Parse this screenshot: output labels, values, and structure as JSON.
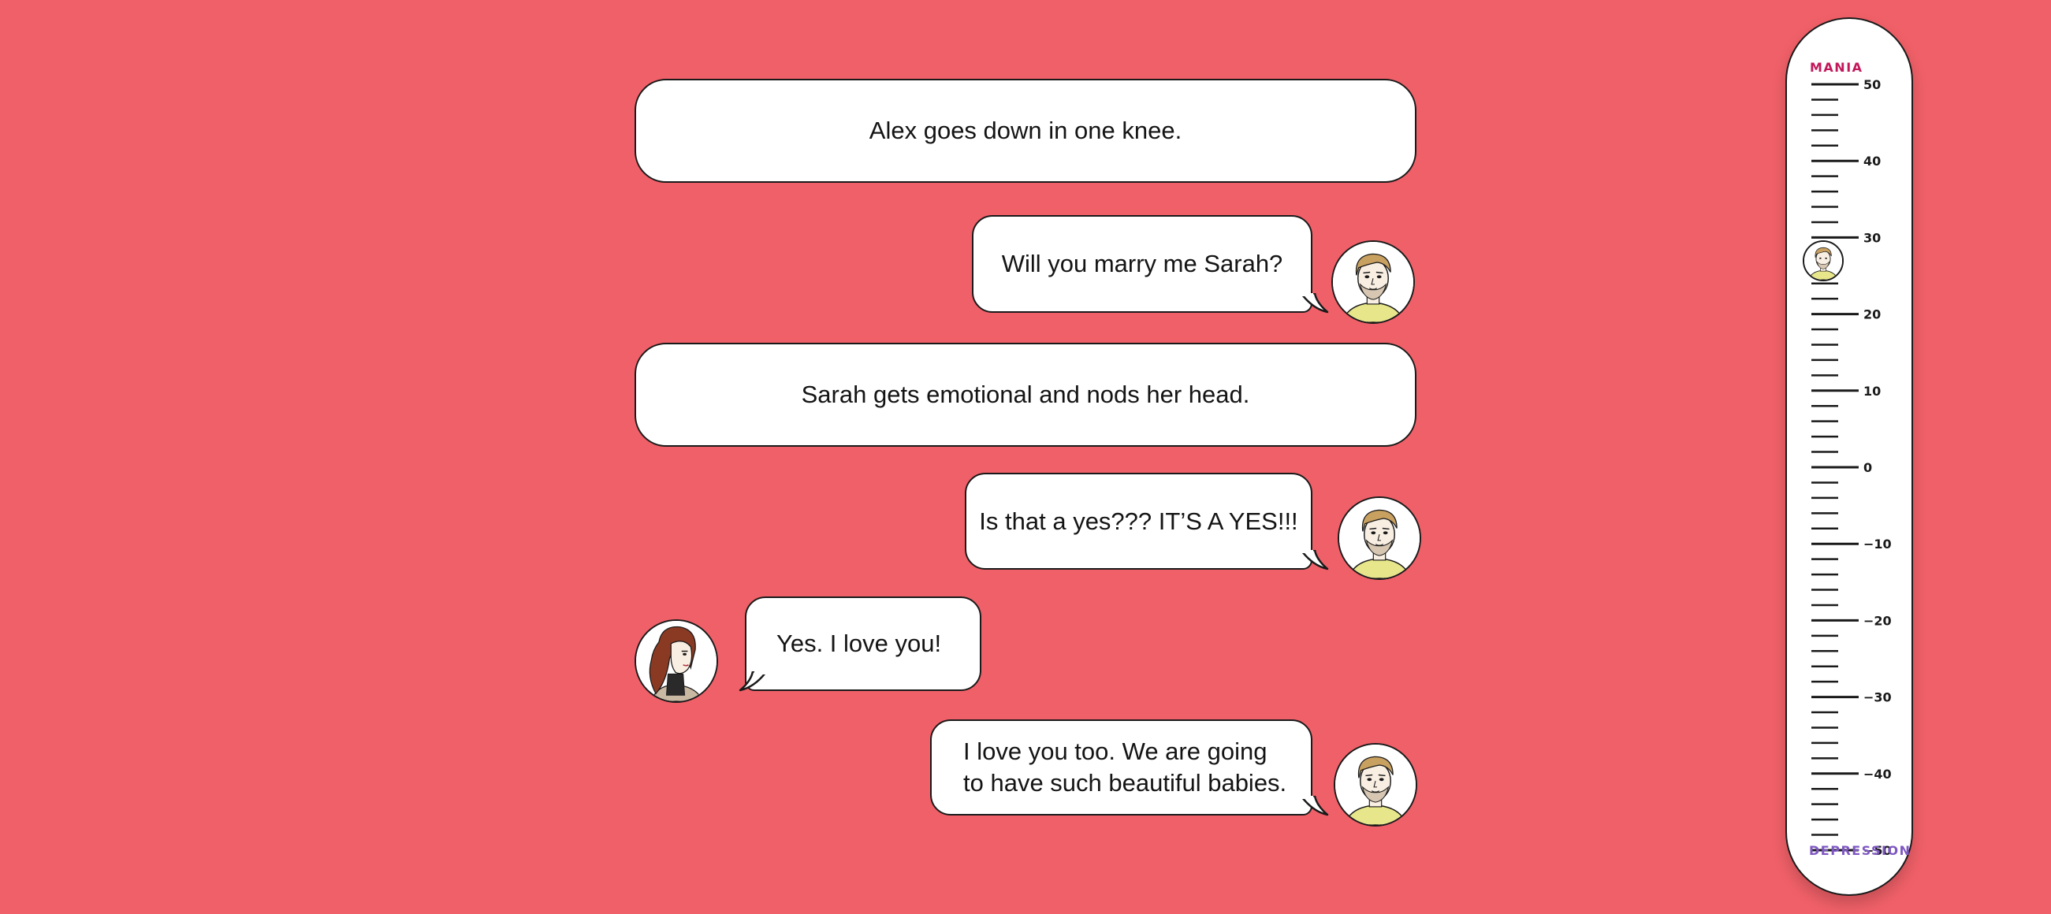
{
  "messages": [
    {
      "type": "narration",
      "text": "Alex goes down in one knee."
    },
    {
      "type": "speech",
      "speaker": "Alex",
      "side": "right",
      "text": "Will you marry me Sarah?"
    },
    {
      "type": "narration",
      "text": "Sarah gets emotional and nods her head."
    },
    {
      "type": "speech",
      "speaker": "Alex",
      "side": "right",
      "text": "Is that a yes??? IT’S A YES!!!"
    },
    {
      "type": "speech",
      "speaker": "Sarah",
      "side": "left",
      "text": "Yes. I love you!"
    },
    {
      "type": "speech",
      "speaker": "Alex",
      "side": "right",
      "lines": [
        "I love you too. We are going",
        "to have such beautiful babies."
      ]
    }
  ],
  "meter": {
    "top_label": "MANIA",
    "bottom_label": "DEPRESSION",
    "top_label_color": "#c2185b",
    "bottom_label_color": "#7e57c2",
    "tick_labels": [
      "50",
      "40",
      "30",
      "20",
      "10",
      "0",
      "−10",
      "−20",
      "−30",
      "−40",
      "−50"
    ],
    "min": -50,
    "max": 50,
    "current_value": 27
  },
  "colors": {
    "background": "#f06068",
    "bubble": "#ffffff",
    "outline": "#1a1a1a",
    "alex_shirt": "#e8e68a",
    "alex_hair": "#c8a060",
    "sarah_hair": "#8a3a22"
  },
  "icons": {
    "alex": "alex-avatar-icon",
    "sarah": "sarah-avatar-icon"
  }
}
